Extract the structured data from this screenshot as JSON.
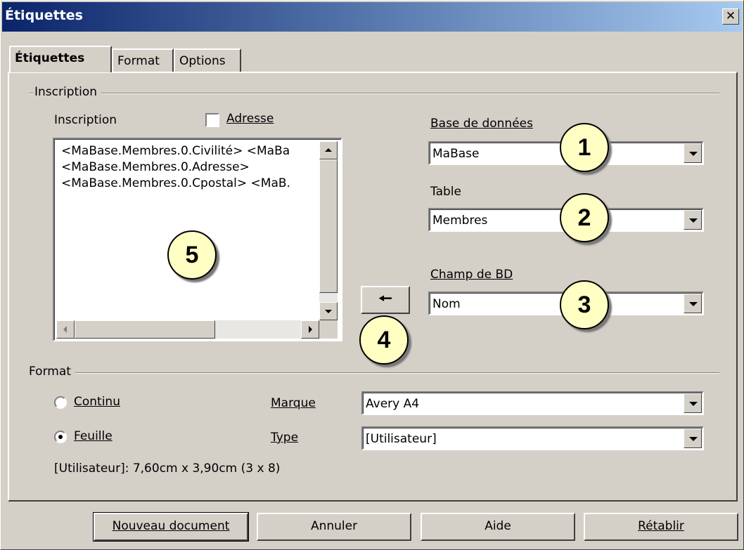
{
  "window": {
    "title": "Étiquettes",
    "close_glyph": "✕"
  },
  "tabs": [
    {
      "label": "Étiquettes",
      "active": true
    },
    {
      "label": "Format",
      "active": false
    },
    {
      "label": "Options",
      "active": false
    }
  ],
  "inscription": {
    "group_title": "Inscription",
    "label": "Inscription",
    "adresse_label": "Adresse",
    "adresse_checked": false,
    "lines": [
      "<MaBase.Membres.0.Civilité> <MaBa",
      "<MaBase.Membres.0.Adresse>",
      "<MaBase.Membres.0.Cpostal> <MaB."
    ]
  },
  "database": {
    "label": "Base de données",
    "value": "MaBase",
    "table_label": "Table",
    "table_value": "Membres",
    "field_label": "Champ de BD",
    "field_value": "Nom",
    "insert_arrow": "🠔"
  },
  "format": {
    "group_title": "Format",
    "continu_label": "Continu",
    "feuille_label": "Feuille",
    "selected": "Feuille",
    "marque_label": "Marque",
    "marque_value": "Avery A4",
    "type_label": "Type",
    "type_value": "[Utilisateur]",
    "size_info": "[Utilisateur]: 7,60cm x 3,90cm (3 x 8)"
  },
  "buttons": {
    "new_document": "Nouveau document",
    "cancel": "Annuler",
    "help": "Aide",
    "reset": "Rétablir"
  },
  "callouts": [
    "1",
    "2",
    "3",
    "4",
    "5"
  ],
  "colors": {
    "titlebar_start": "#0a246a",
    "titlebar_end": "#a6caf0",
    "dialog_bg": "#d4d0c8",
    "callout_fill": "#ffffc4"
  }
}
